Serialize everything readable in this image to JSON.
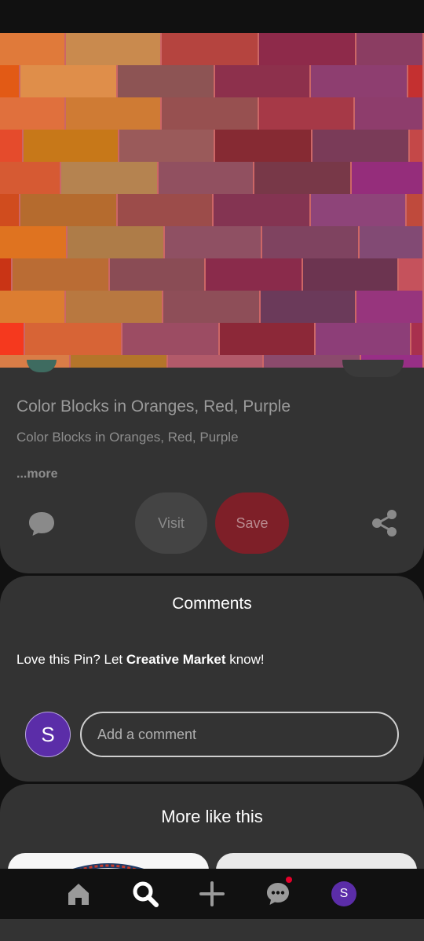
{
  "pin": {
    "title": "Color Blocks in Oranges, Red, Purple",
    "description": "Color Blocks in Oranges, Red, Purple",
    "more_label": "...more",
    "visit_label": "Visit",
    "save_label": "Save"
  },
  "comments": {
    "title": "Comments",
    "prompt_prefix": "Love this Pin? Let ",
    "prompt_brand": "Creative Market",
    "prompt_suffix": " know!",
    "avatar_initial": "S",
    "input_placeholder": "Add a comment"
  },
  "more_like_this": {
    "title": "More like this"
  },
  "nav": {
    "items": [
      {
        "icon": "home-icon"
      },
      {
        "icon": "search-icon"
      },
      {
        "icon": "plus-icon"
      },
      {
        "icon": "messages-icon"
      },
      {
        "icon": "profile-avatar"
      }
    ],
    "profile_initial": "S"
  },
  "colors": {
    "background": "#111111",
    "panel": "#333333",
    "save_button": "#7e1f28",
    "visit_button": "#444444",
    "avatar": "#5b2da8",
    "notification_dot": "#e6002a"
  }
}
